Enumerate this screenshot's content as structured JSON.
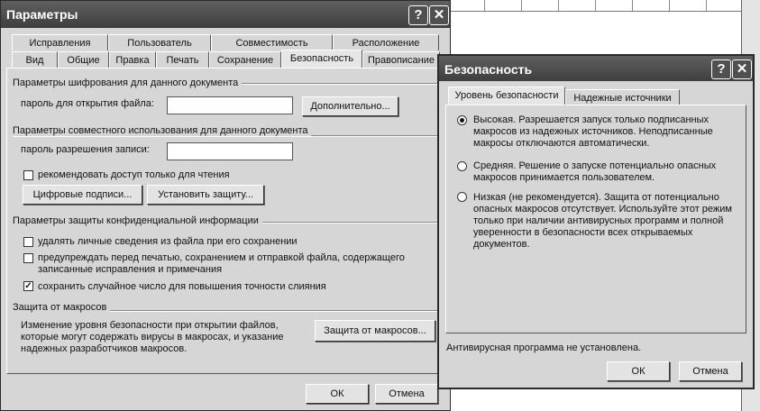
{
  "main_dialog": {
    "title": "Параметры",
    "help": "?",
    "close": "✕",
    "tabs_row1": [
      "Исправления",
      "Пользователь",
      "Совместимость",
      "Расположение"
    ],
    "tabs_row2": [
      "Вид",
      "Общие",
      "Правка",
      "Печать",
      "Сохранение",
      "Безопасность",
      "Правописание"
    ],
    "encryption": {
      "heading": "Параметры шифрования для данного документа",
      "password_label": "пароль для открытия файла:",
      "password_value": "",
      "advanced_button": "Дополнительно..."
    },
    "sharing": {
      "heading": "Параметры совместного использования для данного документа",
      "write_password_label": "пароль разрешения записи:",
      "write_password_value": "",
      "read_only_label": "рекомендовать доступ только для чтения",
      "digital_signatures_button": "Цифровые подписи...",
      "protect_button": "Установить защиту..."
    },
    "privacy": {
      "heading": "Параметры защиты конфиденциальной информации",
      "option1": "удалять личные сведения из файла при его сохранении",
      "option2_line1": "предупреждать перед печатью, сохранением и отправкой файла, содержащего",
      "option2_line2": "записанные исправления и примечания",
      "option3": "сохранить случайное число для повышения точности слияния",
      "option3_checked": "✓"
    },
    "macro": {
      "heading": "Защита от макросов",
      "desc_line1": "Изменение уровня безопасности при открытии файлов,",
      "desc_line2": "которые могут содержать вирусы в макросах, и указание",
      "desc_line3": "надежных разработчиков макросов.",
      "button": "Защита от макросов..."
    },
    "ok": "ОК",
    "cancel": "Отмена"
  },
  "security_dialog": {
    "title": "Безопасность",
    "help": "?",
    "close": "✕",
    "tabs": [
      "Уровень безопасности",
      "Надежные источники"
    ],
    "high": {
      "line1": "Высокая. Разрешается запуск только подписанных",
      "line2": "макросов из надежных источников. Неподписанные",
      "line3": "макросы отключаются автоматически."
    },
    "medium": {
      "line1": "Средняя. Решение о запуске потенциально опасных",
      "line2": "макросов принимается пользователем."
    },
    "low": {
      "line1": "Низкая (не рекомендуется). Защита от потенциально",
      "line2": "опасных макросов отсутствует. Используйте этот режим",
      "line3": "только при наличии антивирусных программ и полной",
      "line4": "уверенности в безопасности всех открываемых",
      "line5": "документов."
    },
    "antivirus_status": "Антивирусная программа не установлена.",
    "ok": "ОК",
    "cancel": "Отмена"
  }
}
